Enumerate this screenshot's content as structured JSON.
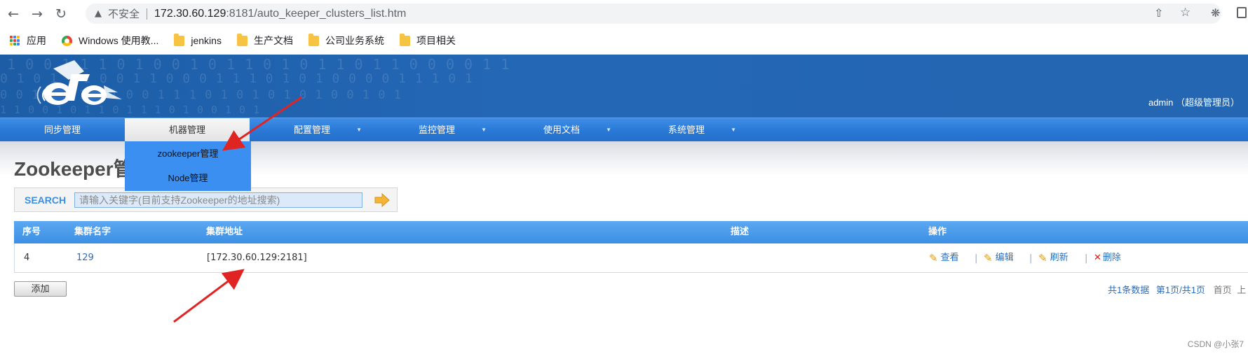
{
  "browser": {
    "insecure_label": "不安全",
    "url_host": "172.30.60.129",
    "url_rest": ":8181/auto_keeper_clusters_list.htm",
    "bookmarks": [
      {
        "label": "应用",
        "icon": "apps-grid-icon"
      },
      {
        "label": "Windows 使用教...",
        "icon": "chrome-icon"
      },
      {
        "label": "jenkins",
        "icon": "folder-icon"
      },
      {
        "label": "生产文档",
        "icon": "folder-icon"
      },
      {
        "label": "公司业务系统",
        "icon": "folder-icon"
      },
      {
        "label": "项目相关",
        "icon": "folder-icon"
      }
    ]
  },
  "header": {
    "user": "admin （超级管理员）"
  },
  "nav": {
    "items": [
      {
        "label": "同步管理",
        "active": false,
        "caret": false
      },
      {
        "label": "机器管理",
        "active": true,
        "caret": false
      },
      {
        "label": "配置管理",
        "active": false,
        "caret": true
      },
      {
        "label": "监控管理",
        "active": false,
        "caret": true
      },
      {
        "label": "使用文档",
        "active": false,
        "caret": true
      },
      {
        "label": "系统管理",
        "active": false,
        "caret": true
      }
    ],
    "dropdown": [
      {
        "label": "zookeeper管理"
      },
      {
        "label": "Node管理"
      }
    ]
  },
  "page": {
    "title": "Zookeeper管"
  },
  "search": {
    "label": "SEARCH",
    "placeholder": "请输入关键字(目前支持Zookeeper的地址搜索)"
  },
  "table": {
    "headers": [
      "序号",
      "集群名字",
      "集群地址",
      "描述",
      "操作"
    ],
    "rows": [
      {
        "id": "4",
        "name": "129",
        "address": "[172.30.60.129:2181]",
        "description": ""
      }
    ],
    "actions": {
      "view": "查看",
      "edit": "编辑",
      "refresh": "刷新",
      "delete": "删除",
      "separator": "|"
    }
  },
  "footer": {
    "add_label": "添加",
    "total": "共1条数据",
    "page_info": "第1页/共1页",
    "first": "首页",
    "prev_cut": "上"
  },
  "watermark": "CSDN @小张7",
  "colors": {
    "header_blue": "#2467b5",
    "nav_blue": "#2a78d6",
    "dropdown_blue": "#3b8ff0",
    "link_blue": "#2a6fbf",
    "annotation_red": "#e02424"
  }
}
